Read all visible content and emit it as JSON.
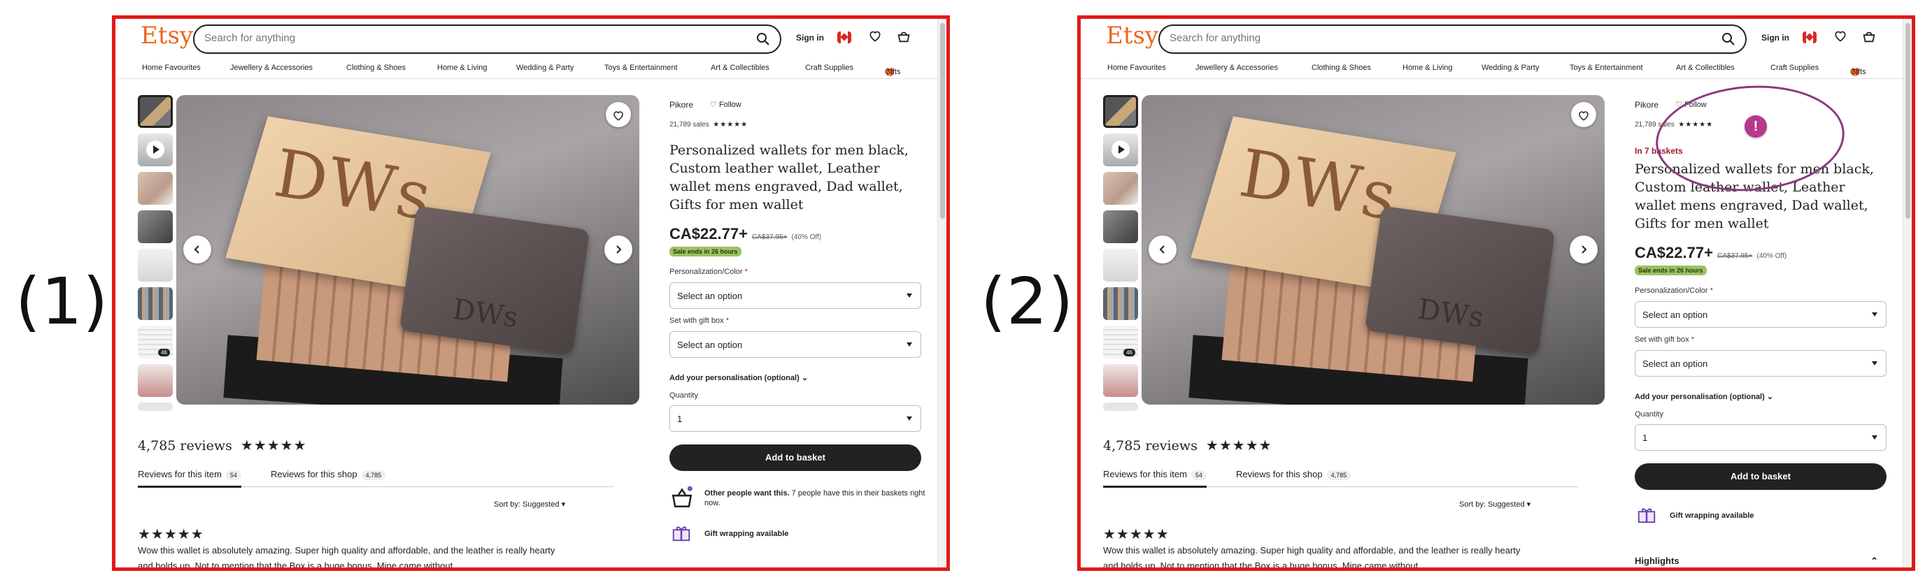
{
  "labels": {
    "panel1": "(1)",
    "panel2": "(2)"
  },
  "header": {
    "logo": "Etsy",
    "search_placeholder": "Search for anything",
    "sign_in": "Sign in",
    "icons": [
      "search-icon",
      "canada-flag-icon",
      "heart-icon",
      "basket-icon"
    ]
  },
  "nav": [
    "Home Favourites",
    "Jewellery & Accessories",
    "Clothing & Shoes",
    "Home & Living",
    "Wedding & Party",
    "Toys & Entertainment",
    "Art & Collectibles",
    "Craft Supplies",
    "Gifts"
  ],
  "gallery": {
    "thumb_count_badge": "46"
  },
  "product": {
    "shop_name": "Pikore",
    "follow": "Follow",
    "sales": "21,789 sales",
    "rating_stars": "★★★★★",
    "in_baskets": "In 7 baskets",
    "title": "Personalized wallets for men black, Custom leather wallet, Leather wallet mens engraved, Dad wallet, Gifts for men wallet",
    "price": "CA$22.77+",
    "original_price": "CA$37.95+",
    "discount": "(40% Off)",
    "sale_badge": "Sale ends in 26 hours",
    "option1_label": "Personalization/Color",
    "option2_label": "Set with gift box",
    "required_mark": "*",
    "select_placeholder": "Select an option",
    "personalisation": "Add your personalisation (optional)",
    "quantity_label": "Quantity",
    "quantity_value": "1",
    "add_to_basket": "Add to basket",
    "others_bold": "Other people want this.",
    "others_rest": " 7 people have this in their baskets right now.",
    "gift_wrapping": "Gift wrapping available",
    "highlights": "Highlights"
  },
  "reviews": {
    "heading": "4,785 reviews",
    "stars": "★★★★★",
    "tab_item": "Reviews for this item",
    "tab_item_count": "54",
    "tab_shop": "Reviews for this shop",
    "tab_shop_count": "4,785",
    "sort": "Sort by: Suggested",
    "review_stars": "★★★★★",
    "review_text": "Wow this wallet is absolutely amazing. Super high quality and affordable, and the leather is really hearty and holds up. Not to mention that the Box is a huge bonus. Mine came without"
  },
  "annotation": {
    "badge": "!"
  },
  "colors": {
    "brand": "#f1641e",
    "border": "#e21a1a",
    "annotation": "#8b3a7e",
    "sale_badge": "#9ec062",
    "baskets": "#a61a2e"
  }
}
